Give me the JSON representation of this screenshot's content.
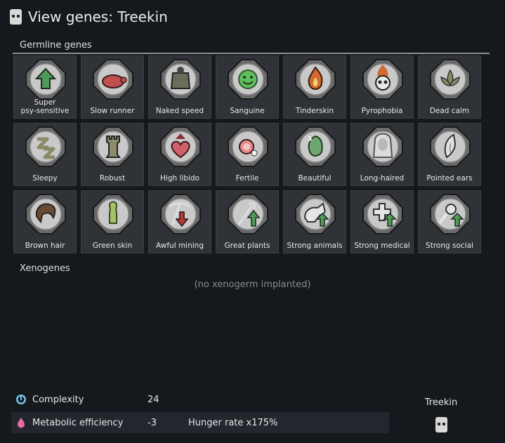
{
  "window": {
    "title": "View genes: Treekin",
    "icon": "xenotype-icon"
  },
  "germline": {
    "label": "Germline genes",
    "genes": [
      {
        "label": "Super\npsy-sensitive",
        "icon": "psy-up-arrow-icon"
      },
      {
        "label": "Slow runner",
        "icon": "turtle-icon"
      },
      {
        "label": "Naked speed",
        "icon": "naked-torso-icon"
      },
      {
        "label": "Sanguine",
        "icon": "smiley-face-icon"
      },
      {
        "label": "Tinderskin",
        "icon": "flame-icon"
      },
      {
        "label": "Pyrophobia",
        "icon": "flaming-skull-icon"
      },
      {
        "label": "Dead calm",
        "icon": "lotus-icon"
      },
      {
        "label": "Sleepy",
        "icon": "zzz-icon"
      },
      {
        "label": "Robust",
        "icon": "tower-icon"
      },
      {
        "label": "High libido",
        "icon": "heart-arrow-icon"
      },
      {
        "label": "Fertile",
        "icon": "egg-sperm-icon"
      },
      {
        "label": "Beautiful",
        "icon": "beautiful-face-icon"
      },
      {
        "label": "Long-haired",
        "icon": "long-hair-icon"
      },
      {
        "label": "Pointed ears",
        "icon": "pointed-ear-icon"
      },
      {
        "label": "Brown hair",
        "icon": "hair-icon"
      },
      {
        "label": "Green skin",
        "icon": "skin-figure-icon"
      },
      {
        "label": "Awful mining",
        "icon": "pickaxe-down-icon"
      },
      {
        "label": "Great plants",
        "icon": "plant-tool-up-icon"
      },
      {
        "label": "Strong animals",
        "icon": "animal-up-icon"
      },
      {
        "label": "Strong medical",
        "icon": "medical-cross-up-icon"
      },
      {
        "label": "Strong social",
        "icon": "social-up-icon"
      }
    ]
  },
  "xenogenes": {
    "label": "Xenogenes",
    "empty_text": "(no xenogerm implanted)"
  },
  "stats": [
    {
      "name": "Complexity",
      "value": "24",
      "extra": "",
      "icon": "complexity-icon",
      "color": "#6ec6e8"
    },
    {
      "name": "Metabolic efficiency",
      "value": "-3",
      "extra": "Hunger rate x175%",
      "icon": "metabolism-icon",
      "color": "#e86aa6"
    }
  ],
  "xenotype": {
    "name": "Treekin",
    "icon": "xenotype-icon"
  }
}
